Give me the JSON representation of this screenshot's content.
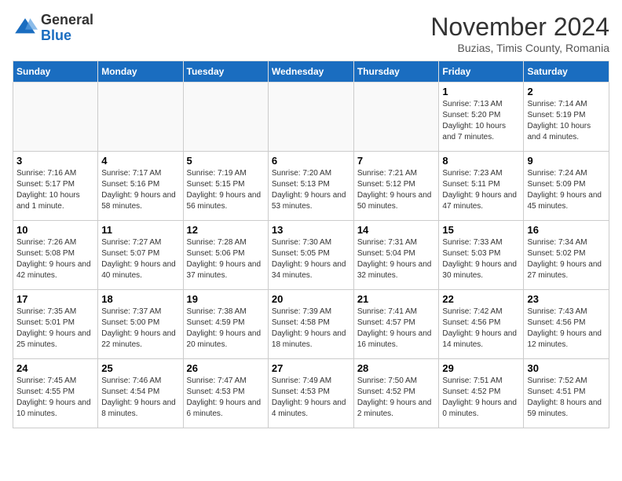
{
  "header": {
    "logo_line1": "General",
    "logo_line2": "Blue",
    "month_title": "November 2024",
    "subtitle": "Buzias, Timis County, Romania"
  },
  "weekdays": [
    "Sunday",
    "Monday",
    "Tuesday",
    "Wednesday",
    "Thursday",
    "Friday",
    "Saturday"
  ],
  "weeks": [
    [
      {
        "day": "",
        "info": ""
      },
      {
        "day": "",
        "info": ""
      },
      {
        "day": "",
        "info": ""
      },
      {
        "day": "",
        "info": ""
      },
      {
        "day": "",
        "info": ""
      },
      {
        "day": "1",
        "info": "Sunrise: 7:13 AM\nSunset: 5:20 PM\nDaylight: 10 hours and 7 minutes."
      },
      {
        "day": "2",
        "info": "Sunrise: 7:14 AM\nSunset: 5:19 PM\nDaylight: 10 hours and 4 minutes."
      }
    ],
    [
      {
        "day": "3",
        "info": "Sunrise: 7:16 AM\nSunset: 5:17 PM\nDaylight: 10 hours and 1 minute."
      },
      {
        "day": "4",
        "info": "Sunrise: 7:17 AM\nSunset: 5:16 PM\nDaylight: 9 hours and 58 minutes."
      },
      {
        "day": "5",
        "info": "Sunrise: 7:19 AM\nSunset: 5:15 PM\nDaylight: 9 hours and 56 minutes."
      },
      {
        "day": "6",
        "info": "Sunrise: 7:20 AM\nSunset: 5:13 PM\nDaylight: 9 hours and 53 minutes."
      },
      {
        "day": "7",
        "info": "Sunrise: 7:21 AM\nSunset: 5:12 PM\nDaylight: 9 hours and 50 minutes."
      },
      {
        "day": "8",
        "info": "Sunrise: 7:23 AM\nSunset: 5:11 PM\nDaylight: 9 hours and 47 minutes."
      },
      {
        "day": "9",
        "info": "Sunrise: 7:24 AM\nSunset: 5:09 PM\nDaylight: 9 hours and 45 minutes."
      }
    ],
    [
      {
        "day": "10",
        "info": "Sunrise: 7:26 AM\nSunset: 5:08 PM\nDaylight: 9 hours and 42 minutes."
      },
      {
        "day": "11",
        "info": "Sunrise: 7:27 AM\nSunset: 5:07 PM\nDaylight: 9 hours and 40 minutes."
      },
      {
        "day": "12",
        "info": "Sunrise: 7:28 AM\nSunset: 5:06 PM\nDaylight: 9 hours and 37 minutes."
      },
      {
        "day": "13",
        "info": "Sunrise: 7:30 AM\nSunset: 5:05 PM\nDaylight: 9 hours and 34 minutes."
      },
      {
        "day": "14",
        "info": "Sunrise: 7:31 AM\nSunset: 5:04 PM\nDaylight: 9 hours and 32 minutes."
      },
      {
        "day": "15",
        "info": "Sunrise: 7:33 AM\nSunset: 5:03 PM\nDaylight: 9 hours and 30 minutes."
      },
      {
        "day": "16",
        "info": "Sunrise: 7:34 AM\nSunset: 5:02 PM\nDaylight: 9 hours and 27 minutes."
      }
    ],
    [
      {
        "day": "17",
        "info": "Sunrise: 7:35 AM\nSunset: 5:01 PM\nDaylight: 9 hours and 25 minutes."
      },
      {
        "day": "18",
        "info": "Sunrise: 7:37 AM\nSunset: 5:00 PM\nDaylight: 9 hours and 22 minutes."
      },
      {
        "day": "19",
        "info": "Sunrise: 7:38 AM\nSunset: 4:59 PM\nDaylight: 9 hours and 20 minutes."
      },
      {
        "day": "20",
        "info": "Sunrise: 7:39 AM\nSunset: 4:58 PM\nDaylight: 9 hours and 18 minutes."
      },
      {
        "day": "21",
        "info": "Sunrise: 7:41 AM\nSunset: 4:57 PM\nDaylight: 9 hours and 16 minutes."
      },
      {
        "day": "22",
        "info": "Sunrise: 7:42 AM\nSunset: 4:56 PM\nDaylight: 9 hours and 14 minutes."
      },
      {
        "day": "23",
        "info": "Sunrise: 7:43 AM\nSunset: 4:56 PM\nDaylight: 9 hours and 12 minutes."
      }
    ],
    [
      {
        "day": "24",
        "info": "Sunrise: 7:45 AM\nSunset: 4:55 PM\nDaylight: 9 hours and 10 minutes."
      },
      {
        "day": "25",
        "info": "Sunrise: 7:46 AM\nSunset: 4:54 PM\nDaylight: 9 hours and 8 minutes."
      },
      {
        "day": "26",
        "info": "Sunrise: 7:47 AM\nSunset: 4:53 PM\nDaylight: 9 hours and 6 minutes."
      },
      {
        "day": "27",
        "info": "Sunrise: 7:49 AM\nSunset: 4:53 PM\nDaylight: 9 hours and 4 minutes."
      },
      {
        "day": "28",
        "info": "Sunrise: 7:50 AM\nSunset: 4:52 PM\nDaylight: 9 hours and 2 minutes."
      },
      {
        "day": "29",
        "info": "Sunrise: 7:51 AM\nSunset: 4:52 PM\nDaylight: 9 hours and 0 minutes."
      },
      {
        "day": "30",
        "info": "Sunrise: 7:52 AM\nSunset: 4:51 PM\nDaylight: 8 hours and 59 minutes."
      }
    ]
  ]
}
